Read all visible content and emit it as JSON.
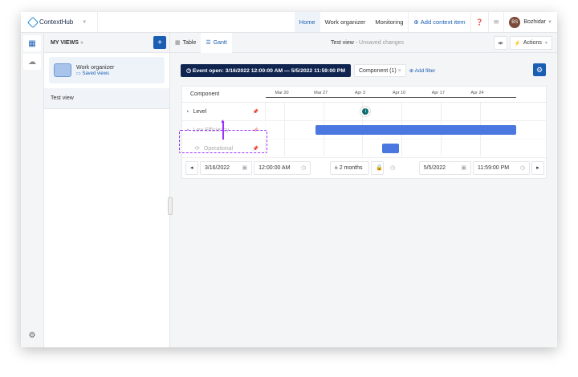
{
  "app": {
    "name": "ContextHub"
  },
  "nav": {
    "items": [
      "Home",
      "Work organizer",
      "Monitoring"
    ],
    "active": "Home",
    "add_context": "Add context item",
    "user_initials": "BS",
    "user_name": "Bozhidar"
  },
  "sidebar": {
    "header": "MY VIEWS",
    "card_title": "Work organizer",
    "card_link": "Saved views",
    "items": [
      "Test view"
    ]
  },
  "toolbar": {
    "tabs": [
      "Table",
      "Gantt"
    ],
    "active_tab": "Gantt",
    "view_title": "Test view",
    "view_status": " - Unsaved changes",
    "actions": "Actions"
  },
  "filters": {
    "event": "Event open: 3/16/2022 12:00:00 AM — 5/5/2022 11:59:00 PM",
    "chip": "Component (1)",
    "add_filter": "Add filter"
  },
  "gantt": {
    "column_header": "Component",
    "ticks": [
      "Mar 20",
      "Mar 27",
      "Apr 3",
      "Apr 10",
      "Apr 17",
      "Apr 24"
    ],
    "rows": [
      {
        "label": "Level"
      },
      {
        "label": "Low Efficiency"
      },
      {
        "label": "Operational"
      }
    ],
    "items": [
      {
        "row": "Level",
        "type": "marker",
        "date": "2022-04-04"
      },
      {
        "row": "Low Efficiency",
        "type": "bar",
        "start": "2022-03-26",
        "end": "2022-05-01"
      },
      {
        "row": "Operational",
        "type": "bar",
        "start": "2022-04-07",
        "end": "2022-04-10"
      }
    ]
  },
  "range": {
    "start_date": "3/16/2022",
    "start_time": "12:00:00 AM",
    "span": "± 2 months",
    "end_date": "5/5/2022",
    "end_time": "11:59:00 PM"
  },
  "colors": {
    "accent": "#1a5fb4",
    "event_chip": "#0f2550",
    "bar": "#4a77e0",
    "drag": "#9b30ff"
  }
}
